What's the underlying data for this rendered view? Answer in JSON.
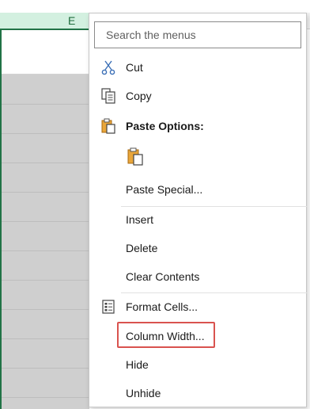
{
  "sheet": {
    "column_letter": "E"
  },
  "menu": {
    "search_placeholder": "Search the menus",
    "items": {
      "cut": "Cut",
      "copy": "Copy",
      "paste_options": "Paste Options:",
      "paste_special": "Paste Special...",
      "insert": "Insert",
      "delete": "Delete",
      "clear_contents": "Clear Contents",
      "format_cells": "Format Cells...",
      "column_width": "Column Width...",
      "hide": "Hide",
      "unhide": "Unhide"
    },
    "icons": [
      "scissors-icon",
      "copy-icon",
      "clipboard-icon",
      "paste-icon",
      "format-cells-icon"
    ],
    "highlight_color": "#d9534f",
    "accent_color": "#217346"
  }
}
